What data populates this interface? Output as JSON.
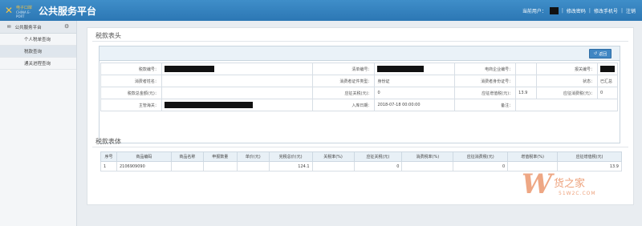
{
  "header": {
    "logo_text": "中国",
    "logo_tiny": "电子口岸",
    "logo_tiny2": "CHINA E-PORT",
    "title": "公共服务平台",
    "user_prefix": "当前用户：",
    "links": [
      "修改密码",
      "修改手机号",
      "注销"
    ],
    "separator": "|"
  },
  "sidebar": {
    "group_label": "公共服务平台",
    "items": [
      "个人税单查询",
      "税款查询",
      "通关进程查询"
    ],
    "active_index": 1
  },
  "main": {
    "header_section_title": "税款表头",
    "return_label": "返回",
    "fields": {
      "tax_no_label": "税款编号：",
      "list_no_label": "清单编号：",
      "order_no_label": "电商企业编号：",
      "declare_no_label": "报关编号：",
      "consumer_name_label": "消费者姓名：",
      "cert_type_label": "消费者证件类型：",
      "cert_type_value": "身份证",
      "cert_no_label": "消费者身份证号：",
      "status_label": "状态：",
      "status_value": "已汇总",
      "tax_total_label": "税款总金额(元)：",
      "duty_label": "应征关税(元)：",
      "duty_value": "0",
      "vat_label": "应征增值税(元)：",
      "vat_value": "13.9",
      "consumption_label": "应征消费税(元)：",
      "consumption_value": "0",
      "customs_label": "主管海关：",
      "entry_date_label": "入库日期：",
      "entry_date_value": "2018-07-18 00:00:00",
      "remark_label": "备注："
    },
    "body_section_title": "税款表体",
    "table": {
      "columns": [
        "序号",
        "商品编码",
        "商品名称",
        "申报数量",
        "单价(元)",
        "完税总价(元)",
        "关税率(%)",
        "应征关税(元)",
        "消费税率(%)",
        "应征消费税(元)",
        "增值税率(%)",
        "应征增值税(元)"
      ],
      "rows": [
        [
          "1",
          "2106909090",
          "",
          "",
          "",
          "124.1",
          "",
          "0",
          "",
          "0",
          "",
          "13.9"
        ]
      ]
    }
  },
  "watermark": {
    "name": "货之家",
    "url": "51W2C.COM"
  },
  "colors": {
    "topbar": "#2c77b4",
    "accent": "#3f86c3",
    "redact": "#111111"
  }
}
